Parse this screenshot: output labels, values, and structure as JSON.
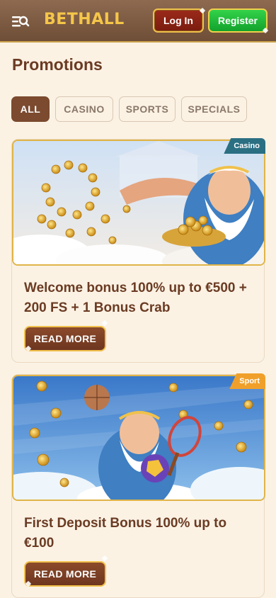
{
  "header": {
    "logo": "BETHALL",
    "login_label": "Log In",
    "register_label": "Register"
  },
  "page_title": "Promotions",
  "tabs": [
    {
      "label": "ALL",
      "active": true
    },
    {
      "label": "CASINO",
      "active": false
    },
    {
      "label": "SPORTS",
      "active": false
    },
    {
      "label": "SPECIALS",
      "active": false
    }
  ],
  "promotions": [
    {
      "tag": "Casino",
      "title": "Welcome bonus 100% up to €500 + 200 FS + 1 Bonus Crab",
      "button": "READ MORE"
    },
    {
      "tag": "Sport",
      "title": "First Deposit Bonus 100% up to €100",
      "button": "READ MORE"
    }
  ],
  "colors": {
    "header_bg": "#7d5a42",
    "accent_gold": "#f0c14b",
    "brown": "#6b3b23",
    "register_green": "#1fb737",
    "login_red": "#8b2416",
    "casino_tag": "#2b6f83",
    "sport_tag": "#f0a02a"
  }
}
